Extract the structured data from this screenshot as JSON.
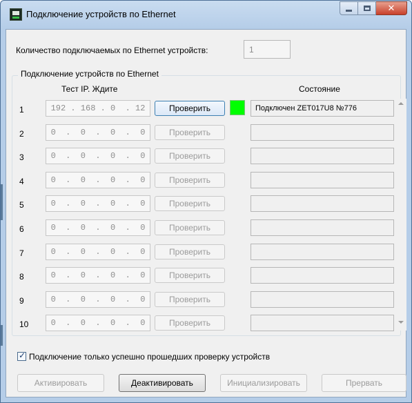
{
  "window": {
    "title": "Подключение устройств по Ethernet",
    "icon": "zet-device-app-icon"
  },
  "count": {
    "label": "Количество подключаемых по Ethernet устройств:",
    "value": "1"
  },
  "group": {
    "title": "Подключение устройств по Ethernet",
    "ip_header": "Тест IP. Ждите",
    "state_header": "Состояние"
  },
  "rows": [
    {
      "num": "1",
      "ip": "192 . 168 . 0  . 12",
      "check_label": "Проверить",
      "status": "Подключен ZET017U8 №776",
      "connected": true
    },
    {
      "num": "2",
      "ip": "0  .  0  .  0  .  0",
      "check_label": "Проверить",
      "status": "",
      "connected": false
    },
    {
      "num": "3",
      "ip": "0  .  0  .  0  .  0",
      "check_label": "Проверить",
      "status": "",
      "connected": false
    },
    {
      "num": "4",
      "ip": "0  .  0  .  0  .  0",
      "check_label": "Проверить",
      "status": "",
      "connected": false
    },
    {
      "num": "5",
      "ip": "0  .  0  .  0  .  0",
      "check_label": "Проверить",
      "status": "",
      "connected": false
    },
    {
      "num": "6",
      "ip": "0  .  0  .  0  .  0",
      "check_label": "Проверить",
      "status": "",
      "connected": false
    },
    {
      "num": "7",
      "ip": "0  .  0  .  0  .  0",
      "check_label": "Проверить",
      "status": "",
      "connected": false
    },
    {
      "num": "8",
      "ip": "0  .  0  .  0  .  0",
      "check_label": "Проверить",
      "status": "",
      "connected": false
    },
    {
      "num": "9",
      "ip": "0  .  0  .  0  .  0",
      "check_label": "Проверить",
      "status": "",
      "connected": false
    },
    {
      "num": "10",
      "ip": "0  .  0  .  0  .  0",
      "check_label": "Проверить",
      "status": "",
      "connected": false
    }
  ],
  "only_checked": {
    "label": "Подключение только успешно прошедших проверку устройств",
    "checked": true
  },
  "buttons": {
    "activate": "Активировать",
    "deactivate": "Деактивировать",
    "initialize": "Инициализировать",
    "abort": "Прервать"
  },
  "colors": {
    "connected_led": "#00ff00",
    "window_frame": "#b5cde8",
    "close_button": "#c8402a"
  }
}
